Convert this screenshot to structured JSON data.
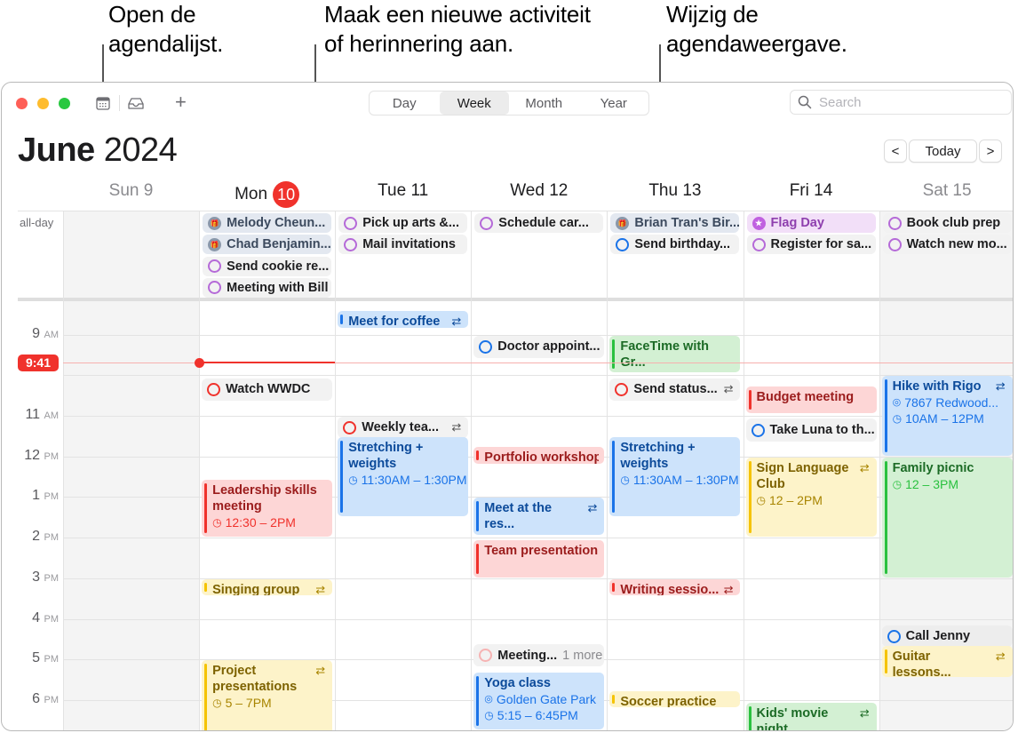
{
  "callouts": [
    {
      "text_line1": "Open de",
      "text_line2": "agendalijst."
    },
    {
      "text_line1": "Maak een nieuwe activiteit",
      "text_line2": "of herinnering aan."
    },
    {
      "text_line1": "Wijzig de",
      "text_line2": "agendaweergave."
    }
  ],
  "toolbar": {
    "icons": [
      "calendar-list-icon",
      "inbox-icon",
      "add-icon"
    ],
    "add_label": "+",
    "views": [
      "Day",
      "Week",
      "Month",
      "Year"
    ],
    "active_view": "Week",
    "search_placeholder": "Search"
  },
  "header": {
    "month": "June",
    "year": "2024",
    "prev": "<",
    "today": "Today",
    "next": ">"
  },
  "days": [
    {
      "name": "Sun 9",
      "weekend": true
    },
    {
      "name": "Mon",
      "badge": "10",
      "weekend": false
    },
    {
      "name": "Tue 11",
      "weekend": false
    },
    {
      "name": "Wed 12",
      "weekend": false
    },
    {
      "name": "Thu 13",
      "weekend": false
    },
    {
      "name": "Fri 14",
      "weekend": false
    },
    {
      "name": "Sat 15",
      "weekend": true
    }
  ],
  "allday_label": "all-day",
  "allday": [
    {
      "day": 1,
      "row": 0,
      "title": "Melody Cheun...",
      "kind": "birthday"
    },
    {
      "day": 1,
      "row": 1,
      "title": "Chad Benjamin...",
      "kind": "birthday"
    },
    {
      "day": 1,
      "row": 2,
      "title": "Send cookie re...",
      "kind": "reminder",
      "color": "#b56ad8"
    },
    {
      "day": 1,
      "row": 3,
      "title": "Meeting with Bill",
      "kind": "reminder",
      "color": "#b56ad8"
    },
    {
      "day": 2,
      "row": 0,
      "title": "Pick up arts &...",
      "kind": "reminder",
      "color": "#b56ad8"
    },
    {
      "day": 2,
      "row": 1,
      "title": "Mail invitations",
      "kind": "reminder",
      "color": "#b56ad8"
    },
    {
      "day": 3,
      "row": 0,
      "title": "Schedule car...",
      "kind": "reminder",
      "color": "#b56ad8"
    },
    {
      "day": 4,
      "row": 0,
      "title": "Brian Tran's Bir...",
      "kind": "birthday"
    },
    {
      "day": 4,
      "row": 1,
      "title": "Send birthday...",
      "kind": "reminder",
      "color": "#1a73e8"
    },
    {
      "day": 5,
      "row": 0,
      "title": "Flag Day",
      "kind": "holiday"
    },
    {
      "day": 5,
      "row": 1,
      "title": "Register for sa...",
      "kind": "reminder",
      "color": "#b56ad8"
    },
    {
      "day": 6,
      "row": 0,
      "title": "Book club prep",
      "kind": "reminder",
      "color": "#b56ad8"
    },
    {
      "day": 6,
      "row": 1,
      "title": "Watch new mo...",
      "kind": "reminder",
      "color": "#b56ad8"
    }
  ],
  "hours": [
    {
      "h": 9,
      "num": "9",
      "ampm": "AM"
    },
    {
      "h": 10,
      "num": "",
      "ampm": ""
    },
    {
      "h": 11,
      "num": "11",
      "ampm": "AM"
    },
    {
      "h": 12,
      "num": "12",
      "ampm": "PM"
    },
    {
      "h": 13,
      "num": "1",
      "ampm": "PM"
    },
    {
      "h": 14,
      "num": "2",
      "ampm": "PM"
    },
    {
      "h": 15,
      "num": "3",
      "ampm": "PM"
    },
    {
      "h": 16,
      "num": "4",
      "ampm": "PM"
    },
    {
      "h": 17,
      "num": "5",
      "ampm": "PM"
    },
    {
      "h": 18,
      "num": "6",
      "ampm": "PM"
    }
  ],
  "now": {
    "label": "9:41",
    "time": 9.683,
    "day": 1
  },
  "colors": {
    "blue": {
      "bg": "#cde3fb",
      "bar": "#1a73e8",
      "text": "#0b4a9a"
    },
    "red": {
      "bg": "#fdd6d6",
      "bar": "#f0322c",
      "text": "#9b1c1c"
    },
    "yellow": {
      "bg": "#fdf3c9",
      "bar": "#f5c300",
      "text": "#7d6200"
    },
    "green": {
      "bg": "#d3f0d3",
      "bar": "#2ac13f",
      "text": "#1c6b26"
    },
    "now": "#f0322c"
  },
  "events": [
    {
      "day": 2,
      "start": 8.4,
      "end": 8.85,
      "title": "Meet for coffee",
      "color": "blue",
      "repeat": true
    },
    {
      "day": 1,
      "start": 10.05,
      "end": 10.65,
      "title": "Watch WWDC",
      "type": "reminder",
      "ring": "#f0322c"
    },
    {
      "day": 2,
      "start": 11.0,
      "end": 11.45,
      "title": "Weekly tea...",
      "type": "reminder",
      "ring": "#f0322c",
      "repeat": true
    },
    {
      "day": 2,
      "start": 11.5,
      "end": 13.5,
      "title": "Stretching + weights",
      "color": "blue",
      "time": "11:30AM – 1:30PM"
    },
    {
      "day": 1,
      "start": 12.55,
      "end": 14.0,
      "title": "Leadership skills meeting",
      "color": "red",
      "time": "12:30 – 2PM"
    },
    {
      "day": 1,
      "start": 15.0,
      "end": 15.45,
      "title": "Singing group",
      "color": "yellow",
      "repeat": true
    },
    {
      "day": 1,
      "start": 17.0,
      "end": 19.0,
      "title": "Project presentations",
      "color": "yellow",
      "time": "5 – 7PM",
      "repeat": true
    },
    {
      "day": 3,
      "start": 9.0,
      "end": 9.6,
      "title": "Doctor appoint...",
      "type": "reminder",
      "ring": "#1a73e8"
    },
    {
      "day": 3,
      "start": 11.75,
      "end": 12.2,
      "title": "Portfolio workshop",
      "color": "red"
    },
    {
      "day": 3,
      "start": 13.0,
      "end": 13.95,
      "title": "Meet at the res...",
      "color": "blue",
      "repeat": true
    },
    {
      "day": 3,
      "start": 14.05,
      "end": 15.0,
      "title": "Team presentation",
      "color": "red"
    },
    {
      "day": 3,
      "start": 16.6,
      "end": 17.2,
      "title": "Meeting...",
      "type": "reminder",
      "ring": "#f6b3b3",
      "more": "1 more"
    },
    {
      "day": 3,
      "start": 17.3,
      "end": 18.75,
      "title": "Yoga class",
      "color": "blue",
      "location": "Golden Gate Park",
      "time": "5:15 – 6:45PM"
    },
    {
      "day": 4,
      "start": 9.0,
      "end": 9.95,
      "title": "FaceTime with Gr...",
      "color": "green"
    },
    {
      "day": 4,
      "start": 10.05,
      "end": 10.65,
      "title": "Send status...",
      "type": "reminder",
      "ring": "#f0322c",
      "repeat": true
    },
    {
      "day": 4,
      "start": 11.5,
      "end": 13.5,
      "title": "Stretching + weights",
      "color": "blue",
      "time": "11:30AM – 1:30PM"
    },
    {
      "day": 4,
      "start": 15.0,
      "end": 15.45,
      "title": "Writing sessio...",
      "color": "red",
      "repeat": true
    },
    {
      "day": 4,
      "start": 17.75,
      "end": 18.2,
      "title": "Soccer practice",
      "color": "yellow"
    },
    {
      "day": 5,
      "start": 10.25,
      "end": 10.95,
      "title": "Budget meeting",
      "color": "red"
    },
    {
      "day": 5,
      "start": 11.05,
      "end": 11.65,
      "title": "Take Luna to th...",
      "type": "reminder",
      "ring": "#1a73e8"
    },
    {
      "day": 5,
      "start": 12.0,
      "end": 14.0,
      "title": "Sign Language Club",
      "color": "yellow",
      "time": "12 – 2PM",
      "repeat": true
    },
    {
      "day": 5,
      "start": 18.05,
      "end": 19.0,
      "title": "Kids' movie night",
      "color": "green",
      "repeat": true
    },
    {
      "day": 6,
      "start": 10.0,
      "end": 12.0,
      "title": "Hike with Rigo",
      "color": "blue",
      "location": "7867 Redwood...",
      "time": "10AM – 12PM",
      "repeat": true
    },
    {
      "day": 6,
      "start": 12.0,
      "end": 15.0,
      "title": "Family picnic",
      "color": "green",
      "time": "12 – 3PM"
    },
    {
      "day": 6,
      "start": 16.15,
      "end": 16.65,
      "title": "Call Jenny",
      "type": "reminder",
      "ring": "#1a73e8",
      "plain": true
    },
    {
      "day": 6,
      "start": 16.65,
      "end": 17.45,
      "title": "Guitar lessons...",
      "color": "yellow",
      "repeat": true
    }
  ]
}
